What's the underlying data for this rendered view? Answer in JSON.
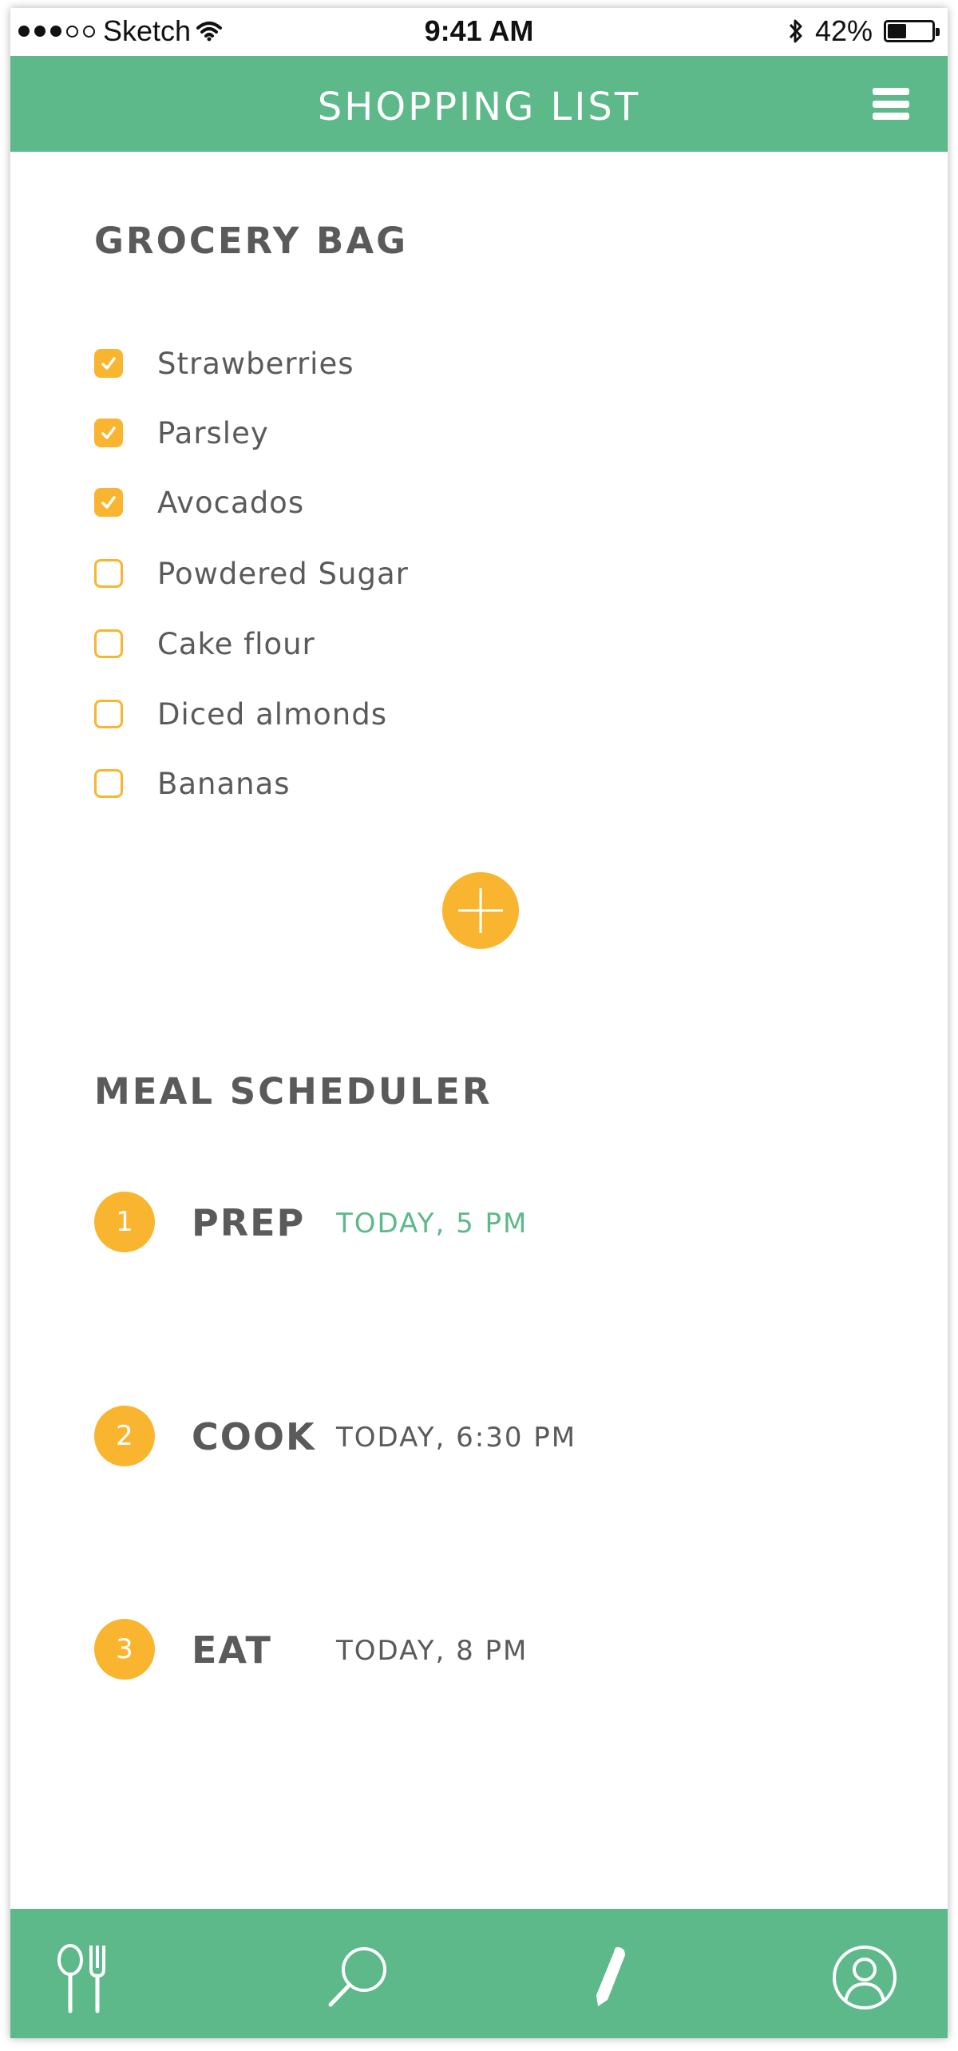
{
  "status_bar": {
    "carrier": "Sketch",
    "time": "9:41 AM",
    "battery_text": "42%",
    "battery_level": 0.42,
    "signal_bars_filled": 3,
    "signal_bars_total": 5
  },
  "header": {
    "title": "SHOPPING LIST",
    "menu_icon": "hamburger-menu-icon"
  },
  "grocery": {
    "title": "GROCERY BAG",
    "items": [
      {
        "label": "Strawberries",
        "checked": true
      },
      {
        "label": "Parsley",
        "checked": true
      },
      {
        "label": "Avocados",
        "checked": true
      },
      {
        "label": "Powdered Sugar",
        "checked": false
      },
      {
        "label": "Cake flour",
        "checked": false
      },
      {
        "label": "Diced almonds",
        "checked": false
      },
      {
        "label": "Bananas",
        "checked": false
      }
    ],
    "add_icon": "plus-icon"
  },
  "scheduler": {
    "title": "MEAL SCHEDULER",
    "steps": [
      {
        "number": "1",
        "name": "PREP",
        "time": "TODAY, 5 PM",
        "active": true
      },
      {
        "number": "2",
        "name": "COOK",
        "time": "TODAY, 6:30 PM",
        "active": false
      },
      {
        "number": "3",
        "name": "EAT",
        "time": "TODAY, 8 PM",
        "active": false
      }
    ]
  },
  "tabbar": {
    "tabs": [
      {
        "icon": "spoon-fork-icon"
      },
      {
        "icon": "search-icon"
      },
      {
        "icon": "pencil-icon"
      },
      {
        "icon": "profile-icon"
      }
    ]
  },
  "colors": {
    "brand_green": "#5db98a",
    "accent_orange": "#f9b530",
    "text_gray": "#5a5a5a",
    "background": "#ffffff"
  }
}
